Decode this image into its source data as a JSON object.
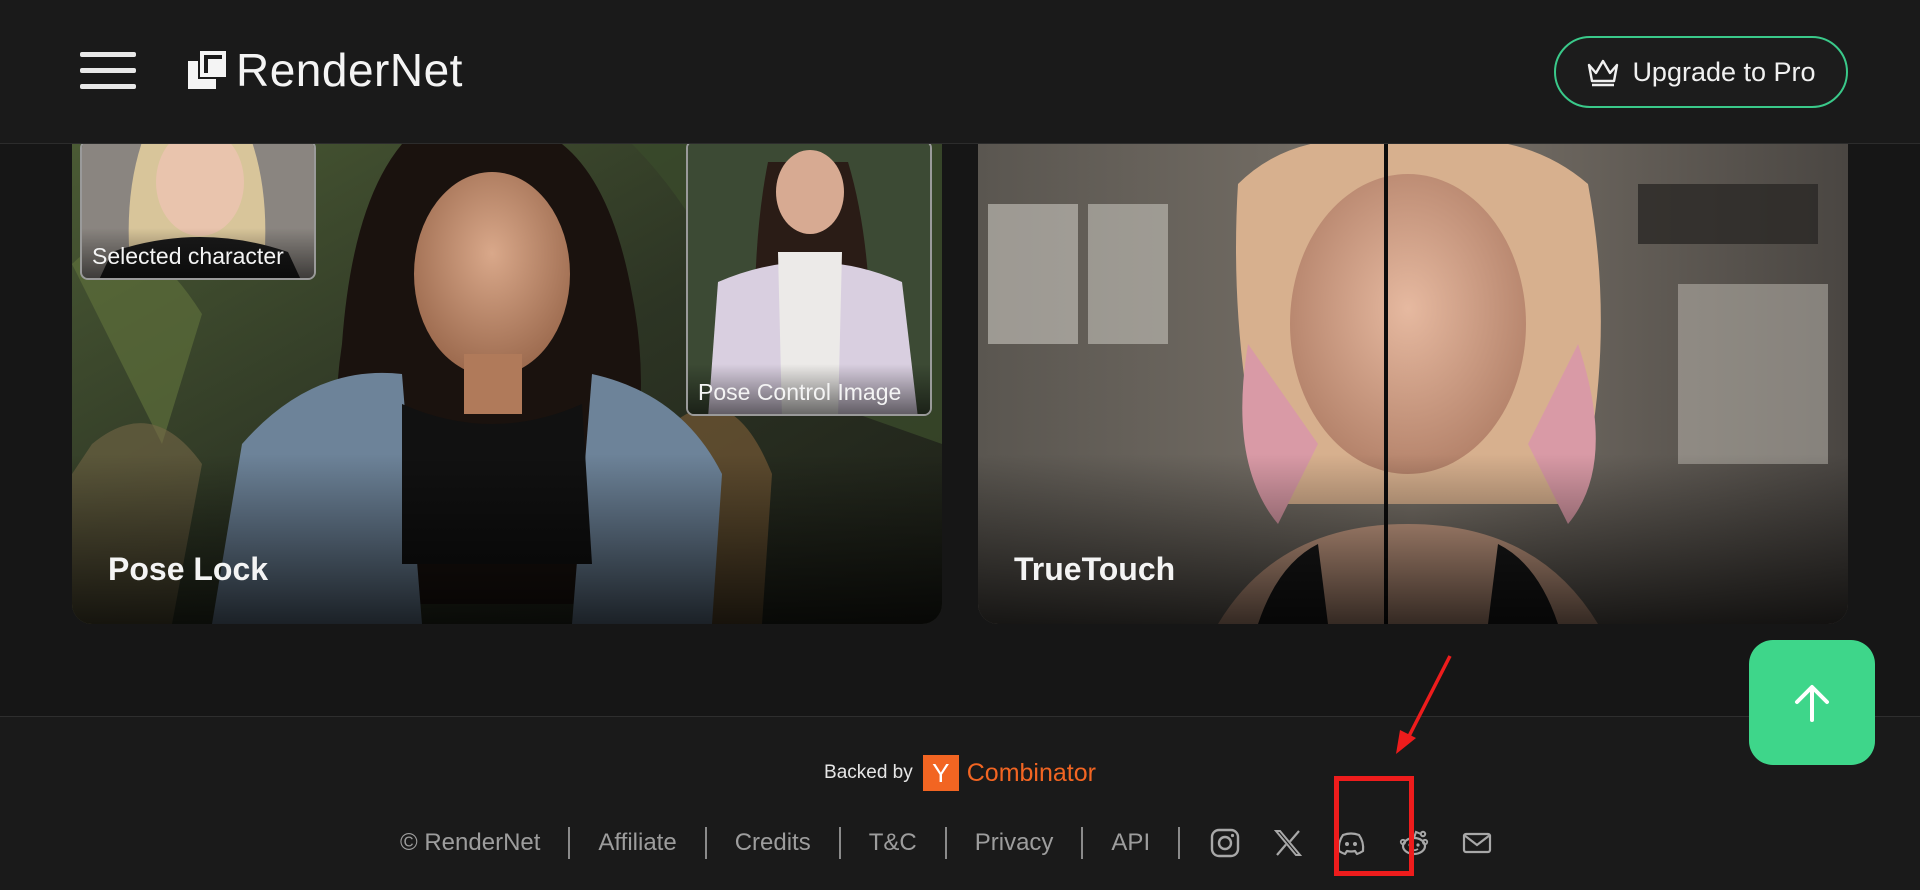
{
  "header": {
    "logo_text": "RenderNet",
    "upgrade_label": "Upgrade to Pro"
  },
  "cards": [
    {
      "title": "Pose Lock",
      "insets": [
        "Selected character",
        "Pose Control Image"
      ]
    },
    {
      "title": "TrueTouch"
    }
  ],
  "footer": {
    "backed_by": "Backed by",
    "yc_letter": "Y",
    "yc_name": "Combinator",
    "links": [
      "© RenderNet",
      "Affiliate",
      "Credits",
      "T&C",
      "Privacy",
      "API"
    ],
    "social_icons": [
      "instagram-icon",
      "x-icon",
      "discord-icon",
      "reddit-icon",
      "mail-icon"
    ]
  },
  "colors": {
    "accent": "#3ed68a",
    "yc_orange": "#f26522",
    "highlight": "#ee1c1c"
  }
}
